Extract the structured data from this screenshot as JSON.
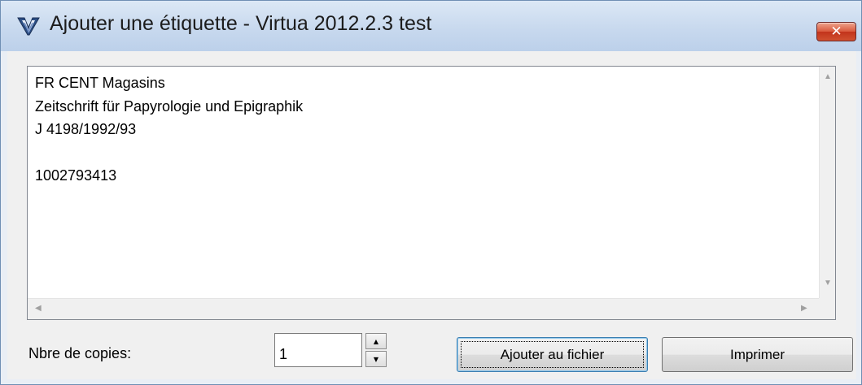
{
  "window": {
    "title": "Ajouter une étiquette - Virtua 2012.2.3 test",
    "close_glyph": "✕"
  },
  "label_text": {
    "lines": [
      "FR CENT Magasins",
      "Zeitschrift für Papyrologie und Epigraphik",
      "J 4198/1992/93",
      "",
      "1002793413"
    ]
  },
  "copies": {
    "label": "Nbre de copies:",
    "value": "1"
  },
  "buttons": {
    "add_to_file": "Ajouter au fichier",
    "print": "Imprimer"
  },
  "icons": {
    "app": "virtua-app-icon",
    "close": "close-icon"
  },
  "colors": {
    "titlebar_top": "#dce8f6",
    "titlebar_bottom": "#bcd0ea",
    "close_red": "#c2341b",
    "client_bg": "#f0f0f0"
  }
}
